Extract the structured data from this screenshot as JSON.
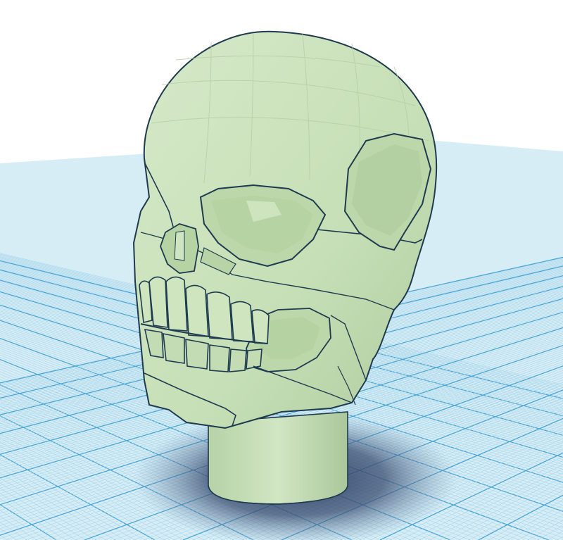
{
  "scene": {
    "object_name": "skull-on-cylinder-model",
    "icon": "skull-model-icon"
  },
  "colors": {
    "background": "#ffffff",
    "grid_fill": "#d7eef7",
    "grid_minor": "#a9d6ea",
    "grid_major": "#4aa6d6",
    "model_fill": "#c8e0b8",
    "model_light": "#d9eccb",
    "model_shade": "#a9c79a",
    "model_dark": "#8fb07f",
    "edge": "#1e3a4e",
    "shadow": "#3a4d70"
  }
}
